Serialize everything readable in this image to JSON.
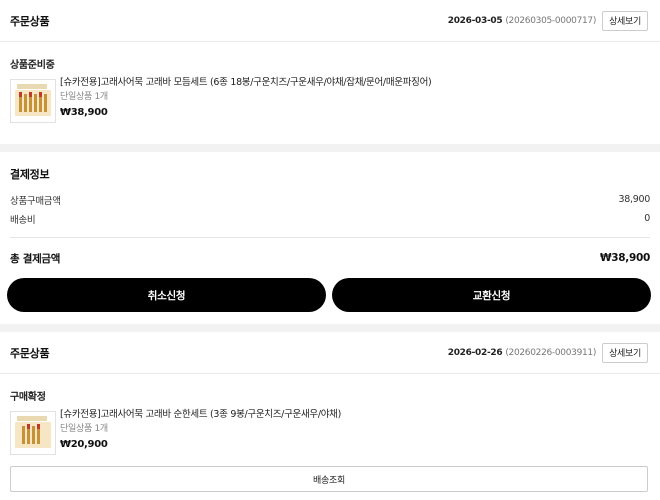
{
  "orders": [
    {
      "section_title": "주문상품",
      "date": "2026-03-05",
      "order_no": "(20260305-0000717)",
      "detail_label": "상세보기",
      "status": "상품준비중",
      "product": {
        "name": "[슈카전용]고래사어묵 고래바 모듬세트 (6종 18봉/구운치즈/구운새우/야채/잡채/문어/매운파징어)",
        "qty": "단일상품 1개",
        "price": "₩38,900",
        "thumb_icon": "product-gift-box-thumbnail"
      }
    },
    {
      "section_title": "주문상품",
      "date": "2026-02-26",
      "order_no": "(20260226-0003911)",
      "detail_label": "상세보기",
      "status": "구매확정",
      "product": {
        "name": "[슈카전용]고래사어묵 고래바 순한세트 (3종 9봉/구운치즈/구운새우/야채)",
        "qty": "단일상품 1개",
        "price": "₩20,900",
        "thumb_icon": "product-gift-box-thumbnail"
      },
      "track_label": "배송조회"
    }
  ],
  "payment": {
    "title": "결제정보",
    "rows": [
      {
        "label": "상품구매금액",
        "value": "38,900"
      },
      {
        "label": "배송비",
        "value": "0"
      }
    ],
    "total_label": "총 결제금액",
    "total_value": "₩38,900"
  },
  "actions": {
    "cancel_label": "취소신청",
    "exchange_label": "교환신청"
  },
  "colors": {
    "button_bg": "#000000",
    "page_bg": "#f2f2f2"
  }
}
